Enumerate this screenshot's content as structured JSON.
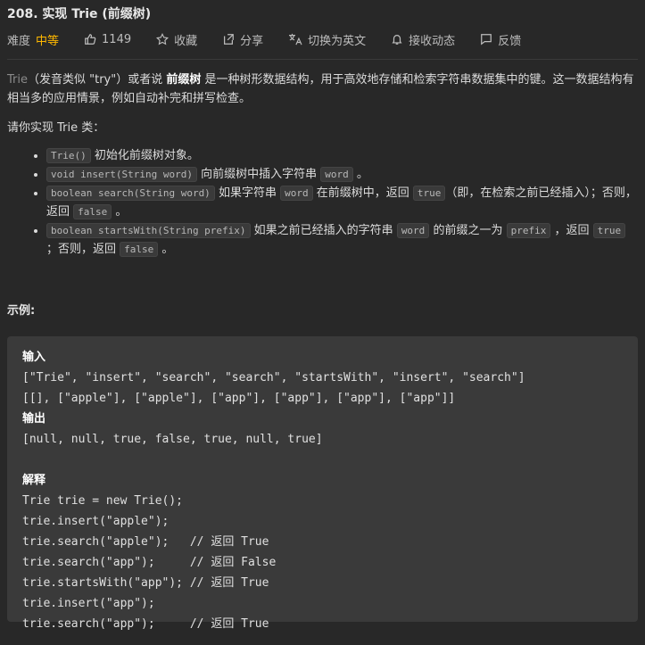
{
  "problem": {
    "title": "208. 实现 Trie (前缀树)"
  },
  "meta": {
    "difficulty_label": "难度",
    "difficulty_value": "中等",
    "likes": "1149",
    "favorite": "收藏",
    "share": "分享",
    "switch_lang": "切换为英文",
    "subscribe": "接收动态",
    "feedback": "反馈"
  },
  "description": {
    "p1_prefix": "Trie",
    "p1_a": "（发音类似 \"try\"）或者说 ",
    "p1_bold": "前缀树",
    "p1_b": " 是一种树形数据结构，用于高效地存储和检索字符串数据集中的键。这一数据结构有相当多的应用情景，例如自动补完和拼写检查。",
    "p2": "请你实现 Trie 类：",
    "items": [
      {
        "code1": "Trie()",
        "text1": " 初始化前缀树对象。"
      },
      {
        "code1": "void insert(String word)",
        "text1": " 向前缀树中插入字符串 ",
        "code2": "word",
        "text2": " 。"
      },
      {
        "code1": "boolean search(String word)",
        "text1": " 如果字符串 ",
        "code2": "word",
        "text2": " 在前缀树中，返回 ",
        "code3": "true",
        "text3": "（即，在检索之前已经插入）；否则，返回 ",
        "code4": "false",
        "text4": " 。"
      },
      {
        "code1": "boolean startsWith(String prefix)",
        "text1": " 如果之前已经插入的字符串 ",
        "code2": "word",
        "text2": " 的前缀之一为 ",
        "code3": "prefix",
        "text3": " ，返回 ",
        "code4": "true",
        "text4": " ；否则，返回 ",
        "code5": "false",
        "text5": " 。"
      }
    ]
  },
  "example": {
    "title": "示例:",
    "input_label": "输入",
    "input_line1": "[\"Trie\", \"insert\", \"search\", \"search\", \"startsWith\", \"insert\", \"search\"]",
    "input_line2": "[[], [\"apple\"], [\"apple\"], [\"app\"], [\"app\"], [\"app\"], [\"app\"]]",
    "output_label": "输出",
    "output_line": "[null, null, true, false, true, null, true]",
    "explain_label": "解释",
    "explain_lines": [
      "Trie trie = new Trie();",
      "trie.insert(\"apple\");",
      "trie.search(\"apple\");   // 返回 True",
      "trie.search(\"app\");     // 返回 False",
      "trie.startsWith(\"app\"); // 返回 True",
      "trie.insert(\"app\");",
      "trie.search(\"app\");     // 返回 True"
    ]
  }
}
